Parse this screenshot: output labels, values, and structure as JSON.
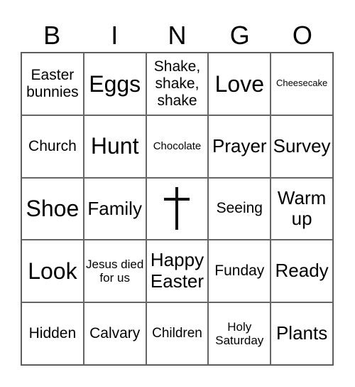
{
  "header": [
    "B",
    "I",
    "N",
    "G",
    "O"
  ],
  "cells": [
    {
      "text": "Easter bunnies",
      "size": "s-m"
    },
    {
      "text": "Eggs",
      "size": "s-xl"
    },
    {
      "text": "Shake, shake, shake",
      "size": "s-m"
    },
    {
      "text": "Love",
      "size": "s-xl"
    },
    {
      "text": "Cheesecake",
      "size": "s-xs"
    },
    {
      "text": "Church",
      "size": "s-m"
    },
    {
      "text": "Hunt",
      "size": "s-xl"
    },
    {
      "text": "Chocolate",
      "size": "s-xxs"
    },
    {
      "text": "Prayer",
      "size": "s-l"
    },
    {
      "text": "Survey",
      "size": "s-l"
    },
    {
      "text": "Shoe",
      "size": "s-xl"
    },
    {
      "text": "Family",
      "size": "s-l"
    },
    {
      "text": "",
      "icon": "cross-icon",
      "size": ""
    },
    {
      "text": "Seeing",
      "size": "s-m"
    },
    {
      "text": "Warm up",
      "size": "s-l"
    },
    {
      "text": "Look",
      "size": "s-xl"
    },
    {
      "text": "Jesus died for us",
      "size": "s-s"
    },
    {
      "text": "Happy Easter",
      "size": "s-l"
    },
    {
      "text": "Funday",
      "size": "s-m"
    },
    {
      "text": "Ready",
      "size": "s-l"
    },
    {
      "text": "Hidden",
      "size": "s-m"
    },
    {
      "text": "Calvary",
      "size": "s-m"
    },
    {
      "text": "Children",
      "size": "s-sm"
    },
    {
      "text": "Holy Saturday",
      "size": "s-s"
    },
    {
      "text": "Plants",
      "size": "s-l"
    }
  ]
}
